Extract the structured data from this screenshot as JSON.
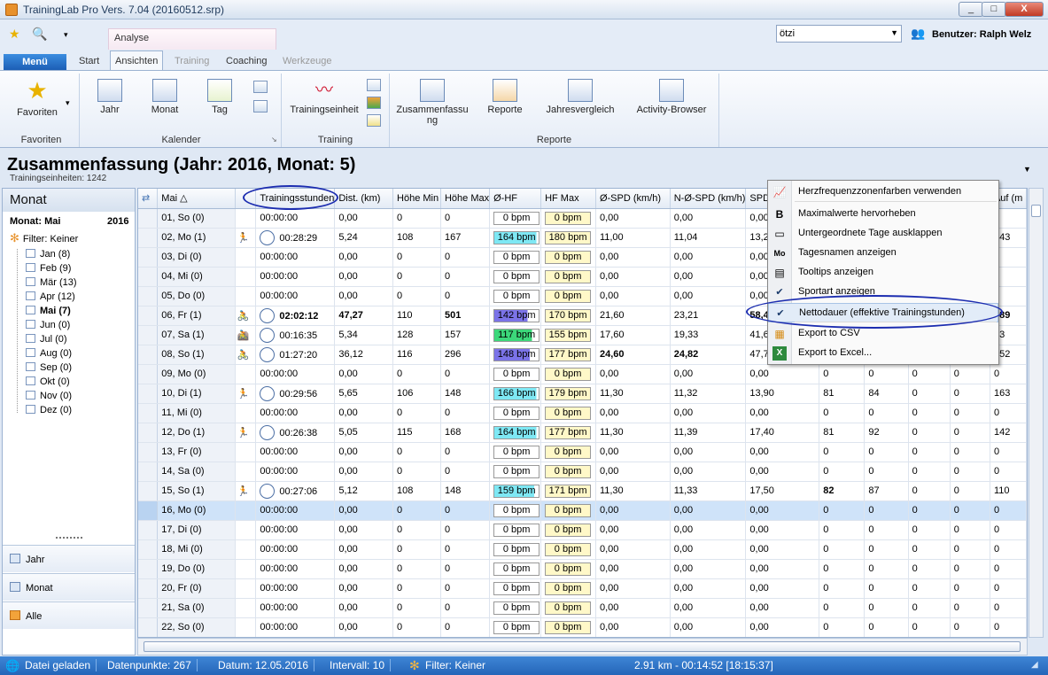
{
  "window": {
    "title": "TrainingLab Pro Vers. 7.04 (20160512.srp)",
    "min": "_",
    "max": "□",
    "close": "X"
  },
  "qat": {
    "context_label": "Analyse",
    "user_select": "ötzi",
    "user_label": "Benutzer: Ralph Welz"
  },
  "tabs": {
    "menu": "Menü",
    "items": [
      "Start",
      "Ansichten",
      "Training",
      "Coaching",
      "Werkzeuge"
    ]
  },
  "ribbon": {
    "groups": {
      "favoriten": "Favoriten",
      "kalender": "Kalender",
      "training": "Training",
      "reporte": "Reporte"
    },
    "buttons": {
      "favoriten": "Favoriten",
      "jahr": "Jahr",
      "monat": "Monat",
      "tag": "Tag",
      "trainingseinheit": "Trainingseinheit",
      "zusammenfassung_1": "Zusammenfassu",
      "zusammenfassung_2": "ng",
      "reporte": "Reporte",
      "jahresvergleich": "Jahresvergleich",
      "activity_browser": "Activity-Browser"
    }
  },
  "summary": {
    "title": "Zusammenfassung (Jahr: 2016, Monat: 5)",
    "subtitle": "Trainingseinheiten: 1242"
  },
  "leftpane": {
    "header": "Monat",
    "month_label": "Monat: Mai",
    "year": "2016",
    "filter": "Filter: Keiner",
    "months": [
      "Jan (8)",
      "Feb (9)",
      "Mär (13)",
      "Apr (12)",
      "Mai (7)",
      "Jun (0)",
      "Jul (0)",
      "Aug (0)",
      "Sep (0)",
      "Okt (0)",
      "Nov (0)",
      "Dez (0)"
    ],
    "selected_month": 4,
    "nav": [
      "Jahr",
      "Monat",
      "Alle"
    ]
  },
  "grid": {
    "columns": [
      "Mai △",
      "",
      "Trainingsstunden",
      "Dist. (km)",
      "Höhe Min",
      "Höhe Max",
      "Ø-HF",
      "HF Max",
      "Ø-SPD (km/h)",
      "N-Ø-SPD (km/h)",
      "SPD",
      "",
      "",
      "",
      "",
      "Auf (m"
    ],
    "rows": [
      {
        "day": "01, So (0)",
        "icon": "",
        "pie": false,
        "time": "00:00:00",
        "dist": "0,00",
        "hmin": "0",
        "hmax": "0",
        "hf": "0 bpm",
        "hfmax": "0 bpm",
        "spd": "0,00",
        "nspd": "0,00",
        "c10": "0,00",
        "c11": "0",
        "c12": "0",
        "c13": "0",
        "c14": "0",
        "c15": "0"
      },
      {
        "day": "02, Mo (1)",
        "icon": "run",
        "pie": true,
        "time": "00:28:29",
        "dist": "5,24",
        "hmin": "108",
        "hmax": "167",
        "hf": "164 bpm",
        "hfcol": "#7ee8f4",
        "hfw": 0.95,
        "hfmax": "180 bpm",
        "spd": "11,00",
        "nspd": "11,04",
        "c10": "13,2",
        "c11": "",
        "c12": "",
        "c13": "",
        "c14": "",
        "c15": "143"
      },
      {
        "day": "03, Di (0)",
        "icon": "",
        "pie": false,
        "time": "00:00:00",
        "dist": "0,00",
        "hmin": "0",
        "hmax": "0",
        "hf": "0 bpm",
        "hfmax": "0 bpm",
        "spd": "0,00",
        "nspd": "0,00",
        "c10": "0,00",
        "c11": "",
        "c12": "",
        "c13": "",
        "c14": "",
        "c15": "0"
      },
      {
        "day": "04, Mi (0)",
        "icon": "",
        "pie": false,
        "time": "00:00:00",
        "dist": "0,00",
        "hmin": "0",
        "hmax": "0",
        "hf": "0 bpm",
        "hfmax": "0 bpm",
        "spd": "0,00",
        "nspd": "0,00",
        "c10": "0,00",
        "c11": "",
        "c12": "",
        "c13": "",
        "c14": "",
        "c15": "0"
      },
      {
        "day": "05, Do (0)",
        "icon": "",
        "pie": false,
        "time": "00:00:00",
        "dist": "0,00",
        "hmin": "0",
        "hmax": "0",
        "hf": "0 bpm",
        "hfmax": "0 bpm",
        "spd": "0,00",
        "nspd": "0,00",
        "c10": "0,00",
        "c11": "",
        "c12": "",
        "c13": "",
        "c14": "",
        "c15": "0"
      },
      {
        "day": "06, Fr (1)",
        "icon": "bike",
        "pie": true,
        "bold": true,
        "time": "02:02:12",
        "dist": "47,27",
        "hmin": "110",
        "hmax": "501",
        "hf": "142 bpm",
        "hfcol": "#7b73e8",
        "hfw": 0.75,
        "hfmax": "170 bpm",
        "spd": "21,60",
        "nspd": "23,21",
        "c10": "58,4",
        "c11": "",
        "c12": "",
        "c13": "",
        "c14": "",
        "c15": "589"
      },
      {
        "day": "07, Sa (1)",
        "icon": "bike2",
        "pie": true,
        "time": "00:16:35",
        "dist": "5,34",
        "hmin": "128",
        "hmax": "157",
        "hf": "117 bpm",
        "hfcol": "#3cd87a",
        "hfw": 0.85,
        "hfmax": "155 bpm",
        "spd": "17,60",
        "nspd": "19,33",
        "c10": "41,6",
        "c11": "",
        "c12": "",
        "c13": "",
        "c14": "",
        "c15": "33"
      },
      {
        "day": "08, So (1)",
        "icon": "bike",
        "pie": true,
        "time": "01:27:20",
        "dist": "36,12",
        "hmin": "116",
        "hmax": "296",
        "hf": "148 bpm",
        "hfcol": "#7b73e8",
        "hfw": 0.8,
        "hfmax": "177 bpm",
        "spd": "24,60",
        "nspd": "24,82",
        "c10": "47,7",
        "c11": "",
        "c12": "",
        "c13": "",
        "c14": "",
        "c15": "352",
        "boldspd": true
      },
      {
        "day": "09, Mo (0)",
        "icon": "",
        "pie": false,
        "time": "00:00:00",
        "dist": "0,00",
        "hmin": "0",
        "hmax": "0",
        "hf": "0 bpm",
        "hfmax": "0 bpm",
        "spd": "0,00",
        "nspd": "0,00",
        "c10": "0,00",
        "c11": "0",
        "c12": "0",
        "c13": "0",
        "c14": "0",
        "c15": "0"
      },
      {
        "day": "10, Di (1)",
        "icon": "run",
        "pie": true,
        "time": "00:29:56",
        "dist": "5,65",
        "hmin": "106",
        "hmax": "148",
        "hf": "166 bpm",
        "hfcol": "#7ee8f4",
        "hfw": 0.95,
        "hfmax": "179 bpm",
        "spd": "11,30",
        "nspd": "11,32",
        "c10": "13,90",
        "c11": "81",
        "c12": "84",
        "c13": "0",
        "c14": "0",
        "c15": "163"
      },
      {
        "day": "11, Mi (0)",
        "icon": "",
        "pie": false,
        "time": "00:00:00",
        "dist": "0,00",
        "hmin": "0",
        "hmax": "0",
        "hf": "0 bpm",
        "hfmax": "0 bpm",
        "spd": "0,00",
        "nspd": "0,00",
        "c10": "0,00",
        "c11": "0",
        "c12": "0",
        "c13": "0",
        "c14": "0",
        "c15": "0"
      },
      {
        "day": "12, Do (1)",
        "icon": "run",
        "pie": true,
        "time": "00:26:38",
        "dist": "5,05",
        "hmin": "115",
        "hmax": "168",
        "hf": "164 bpm",
        "hfcol": "#7ee8f4",
        "hfw": 0.95,
        "hfmax": "177 bpm",
        "spd": "11,30",
        "nspd": "11,39",
        "c10": "17,40",
        "c11": "81",
        "c12": "92",
        "c13": "0",
        "c14": "0",
        "c15": "142"
      },
      {
        "day": "13, Fr (0)",
        "icon": "",
        "pie": false,
        "time": "00:00:00",
        "dist": "0,00",
        "hmin": "0",
        "hmax": "0",
        "hf": "0 bpm",
        "hfmax": "0 bpm",
        "spd": "0,00",
        "nspd": "0,00",
        "c10": "0,00",
        "c11": "0",
        "c12": "0",
        "c13": "0",
        "c14": "0",
        "c15": "0"
      },
      {
        "day": "14, Sa (0)",
        "icon": "",
        "pie": false,
        "time": "00:00:00",
        "dist": "0,00",
        "hmin": "0",
        "hmax": "0",
        "hf": "0 bpm",
        "hfmax": "0 bpm",
        "spd": "0,00",
        "nspd": "0,00",
        "c10": "0,00",
        "c11": "0",
        "c12": "0",
        "c13": "0",
        "c14": "0",
        "c15": "0"
      },
      {
        "day": "15, So (1)",
        "icon": "run",
        "pie": true,
        "time": "00:27:06",
        "dist": "5,12",
        "hmin": "108",
        "hmax": "148",
        "hf": "159 bpm",
        "hfcol": "#7ee8f4",
        "hfw": 0.9,
        "hfmax": "171 bpm",
        "spd": "11,30",
        "nspd": "11,33",
        "c10": "17,50",
        "c11": "82",
        "c12": "87",
        "c13": "0",
        "c14": "0",
        "c15": "110",
        "boldc11": true
      },
      {
        "day": "16, Mo (0)",
        "icon": "",
        "pie": false,
        "sel": true,
        "time": "00:00:00",
        "dist": "0,00",
        "hmin": "0",
        "hmax": "0",
        "hf": "0 bpm",
        "hfmax": "0 bpm",
        "spd": "0,00",
        "nspd": "0,00",
        "c10": "0,00",
        "c11": "0",
        "c12": "0",
        "c13": "0",
        "c14": "0",
        "c15": "0"
      },
      {
        "day": "17, Di (0)",
        "icon": "",
        "pie": false,
        "time": "00:00:00",
        "dist": "0,00",
        "hmin": "0",
        "hmax": "0",
        "hf": "0 bpm",
        "hfmax": "0 bpm",
        "spd": "0,00",
        "nspd": "0,00",
        "c10": "0,00",
        "c11": "0",
        "c12": "0",
        "c13": "0",
        "c14": "0",
        "c15": "0"
      },
      {
        "day": "18, Mi (0)",
        "icon": "",
        "pie": false,
        "time": "00:00:00",
        "dist": "0,00",
        "hmin": "0",
        "hmax": "0",
        "hf": "0 bpm",
        "hfmax": "0 bpm",
        "spd": "0,00",
        "nspd": "0,00",
        "c10": "0,00",
        "c11": "0",
        "c12": "0",
        "c13": "0",
        "c14": "0",
        "c15": "0"
      },
      {
        "day": "19, Do (0)",
        "icon": "",
        "pie": false,
        "time": "00:00:00",
        "dist": "0,00",
        "hmin": "0",
        "hmax": "0",
        "hf": "0 bpm",
        "hfmax": "0 bpm",
        "spd": "0,00",
        "nspd": "0,00",
        "c10": "0,00",
        "c11": "0",
        "c12": "0",
        "c13": "0",
        "c14": "0",
        "c15": "0"
      },
      {
        "day": "20, Fr (0)",
        "icon": "",
        "pie": false,
        "time": "00:00:00",
        "dist": "0,00",
        "hmin": "0",
        "hmax": "0",
        "hf": "0 bpm",
        "hfmax": "0 bpm",
        "spd": "0,00",
        "nspd": "0,00",
        "c10": "0,00",
        "c11": "0",
        "c12": "0",
        "c13": "0",
        "c14": "0",
        "c15": "0"
      },
      {
        "day": "21, Sa (0)",
        "icon": "",
        "pie": false,
        "time": "00:00:00",
        "dist": "0,00",
        "hmin": "0",
        "hmax": "0",
        "hf": "0 bpm",
        "hfmax": "0 bpm",
        "spd": "0,00",
        "nspd": "0,00",
        "c10": "0,00",
        "c11": "0",
        "c12": "0",
        "c13": "0",
        "c14": "0",
        "c15": "0"
      },
      {
        "day": "22, So (0)",
        "icon": "",
        "pie": false,
        "time": "00:00:00",
        "dist": "0,00",
        "hmin": "0",
        "hmax": "0",
        "hf": "0 bpm",
        "hfmax": "0 bpm",
        "spd": "0,00",
        "nspd": "0,00",
        "c10": "0,00",
        "c11": "0",
        "c12": "0",
        "c13": "0",
        "c14": "0",
        "c15": "0"
      }
    ]
  },
  "contextmenu": {
    "items": [
      {
        "label": "Herzfrequenzzonenfarben verwenden",
        "icon": "zone-chart-icon"
      },
      {
        "label": "Maximalwerte hervorheben",
        "icon": "bold-b-icon"
      },
      {
        "label": "Untergeordnete Tage ausklappen",
        "icon": "expand-icon"
      },
      {
        "label": "Tagesnamen anzeigen",
        "icon": "day-names-icon"
      },
      {
        "label": "Tooltips anzeigen",
        "icon": "tooltip-icon"
      },
      {
        "label": "Sportart anzeigen",
        "icon": "check-icon"
      },
      {
        "label": "Nettodauer (effektive Trainingstunden)",
        "icon": "check-icon"
      },
      {
        "label": "Export to CSV",
        "icon": "csv-icon"
      },
      {
        "label": "Export to Excel...",
        "icon": "excel-icon"
      }
    ]
  },
  "statusbar": {
    "loaded": "Datei geladen",
    "points": "Datenpunkte: 267",
    "date": "Datum: 12.05.2016",
    "interval": "Intervall: 10",
    "filter": "Filter: Keiner",
    "summary": "2.91 km - 00:14:52 [18:15:37]"
  }
}
